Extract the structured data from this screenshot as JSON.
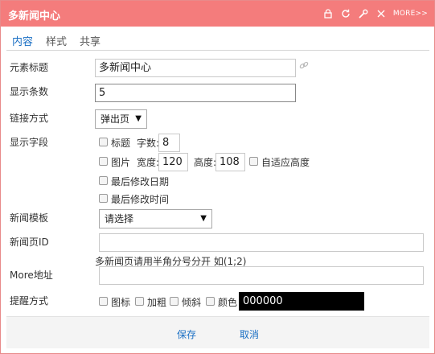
{
  "window": {
    "title": "多新闻中心",
    "more_label": "MORE>>"
  },
  "tabs": [
    {
      "label": "内容",
      "active": true
    },
    {
      "label": "样式",
      "active": false
    },
    {
      "label": "共享",
      "active": false
    }
  ],
  "form": {
    "element_title": {
      "label": "元素标题",
      "value": "多新闻中心"
    },
    "display_count": {
      "label": "显示条数",
      "value": "5"
    },
    "link_mode": {
      "label": "链接方式",
      "selected": "弹出页"
    },
    "display_fields": {
      "label": "显示字段",
      "title_cb": "标题",
      "word_count_label": "字数:",
      "word_count_value": "8",
      "image_cb": "图片",
      "width_label": "宽度:",
      "width_value": "120",
      "height_label": "高度:",
      "height_value": "108",
      "auto_height_cb": "自适应高度",
      "last_modified_date_cb": "最后修改日期",
      "last_modified_time_cb": "最后修改时间"
    },
    "news_template": {
      "label": "新闻模板",
      "selected": "请选择"
    },
    "news_page_id": {
      "label": "新闻页ID",
      "value": "",
      "hint": "多新闻页请用半角分号分开 如(1;2)"
    },
    "more_address": {
      "label": "More地址",
      "value": ""
    },
    "reminder": {
      "label": "提醒方式",
      "icon_cb": "图标",
      "bold_cb": "加粗",
      "italic_cb": "倾斜",
      "color_cb": "颜色",
      "color_value": "000000"
    }
  },
  "footer": {
    "save_label": "保存",
    "cancel_label": "取消"
  },
  "colors": {
    "titlebar": "#f47c7c",
    "accent": "#1a6fc4"
  }
}
